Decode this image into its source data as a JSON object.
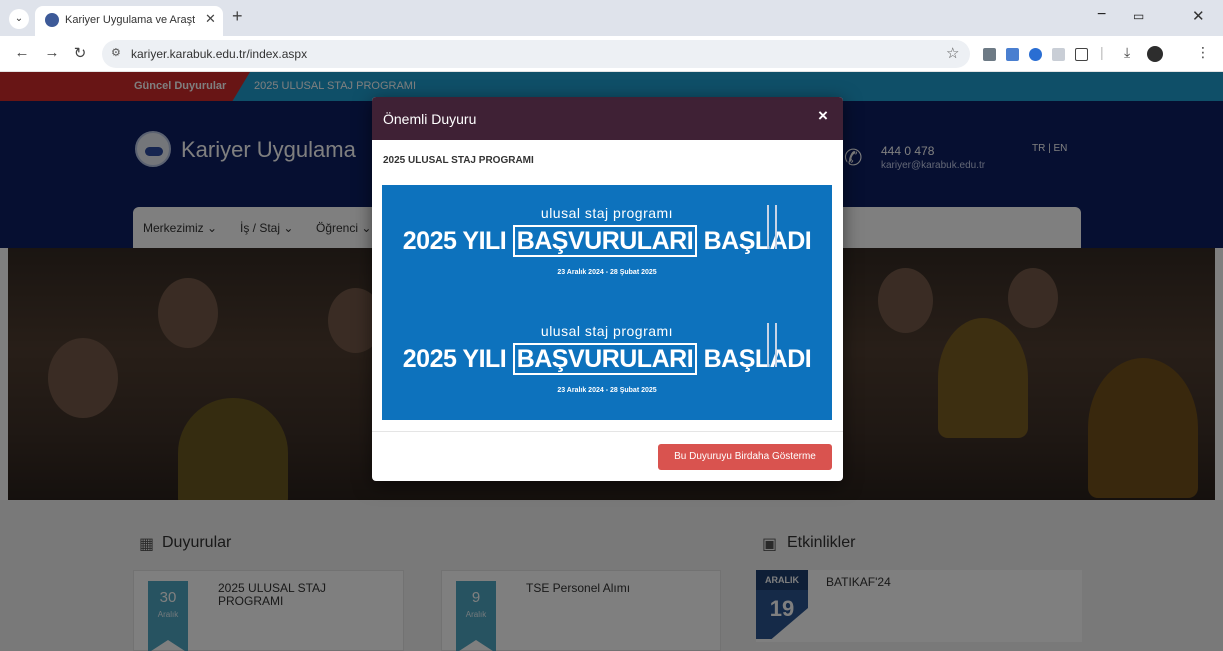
{
  "browser": {
    "tab_title": "Kariyer Uygulama ve Araştırma",
    "url": "kariyer.karabuk.edu.tr/index.aspx",
    "glyphs": {
      "dropdown": "⌄",
      "tab_close": "✕",
      "new_tab": "+",
      "minimize": "−",
      "restore": "▭",
      "close": "✕",
      "back": "←",
      "forward": "→",
      "reload": "↻",
      "site_info": "⚙",
      "star": "☆",
      "download": "⤓",
      "menu": "⋮",
      "sep": "|"
    }
  },
  "page": {
    "ticker": {
      "label": "Güncel Duyurular",
      "text": "2025 ULUSAL STAJ PROGRAMI"
    },
    "header": {
      "brand": "Kariyer Uygulama",
      "phone": "444 0 478",
      "email": "kariyer@karabuk.edu.tr",
      "lang": "TR  |  EN",
      "phone_glyph": "✆"
    },
    "menu": [
      {
        "label": "Merkezimiz ⌄"
      },
      {
        "label": "İş / Staj ⌄"
      },
      {
        "label": "Öğrenci ⌄"
      }
    ],
    "announcements": {
      "title": "Duyurular",
      "icon_glyph": "▦",
      "items": [
        {
          "day": "30",
          "month": "Aralık",
          "title": "2025 ULUSAL STAJ PROGRAMI"
        },
        {
          "day": "9",
          "month": "Aralık",
          "title": "TSE Personel Alımı"
        }
      ]
    },
    "events": {
      "title": "Etkinlikler",
      "icon_glyph": "▣",
      "items": [
        {
          "month": "ARALIK",
          "day": "19",
          "title": "BATIKAF'24"
        }
      ]
    }
  },
  "modal": {
    "title": "Önemli Duyuru",
    "close_glyph": "×",
    "subtitle": "2025 ULUSAL STAJ PROGRAMI",
    "promo": {
      "line1": "ulusal staj programı",
      "line2_a": "2025 YILI",
      "line2_b": "BAŞVURULARI",
      "line2_c": "BAŞLADI",
      "date": "23 Aralık 2024 - 28 Şubat 2025"
    },
    "dismiss_label": "Bu Duyuruyu Birdaha Gösterme"
  },
  "colors": {
    "ticker_red": "#d12b2b",
    "ticker_blue": "#1f9fd0",
    "header_navy": "#0d1f63",
    "modal_header": "#3f2135",
    "banner_blue": "#0d72bd",
    "button_red": "#d9534f"
  }
}
